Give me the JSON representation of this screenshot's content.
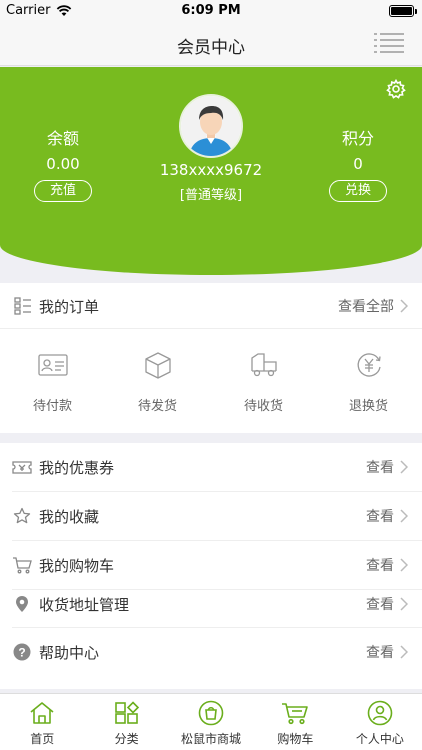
{
  "status_bar": {
    "carrier": "Carrier",
    "time": "6:09 PM"
  },
  "nav": {
    "title": "会员中心",
    "menu_icon": "list-menu-icon"
  },
  "profile": {
    "phone": "138xxxx9672",
    "level": "[普通等级]",
    "balance": {
      "label": "余额",
      "value": "0.00",
      "button": "充值"
    },
    "points": {
      "label": "积分",
      "value": "0",
      "button": "兑换"
    }
  },
  "orders": {
    "title": "我的订单",
    "view_all": "查看全部",
    "items": [
      {
        "label": "待付款",
        "icon": "payment-card-icon"
      },
      {
        "label": "待发货",
        "icon": "package-box-icon"
      },
      {
        "label": "待收货",
        "icon": "delivery-truck-icon"
      },
      {
        "label": "退换货",
        "icon": "refund-yen-icon"
      }
    ]
  },
  "menu": {
    "view_label": "查看",
    "items": [
      {
        "label": "我的优惠券",
        "icon": "coupon-icon"
      },
      {
        "label": "我的收藏",
        "icon": "star-icon"
      },
      {
        "label": "我的购物车",
        "icon": "cart-icon"
      },
      {
        "label": "收货地址管理",
        "icon": "location-pin-icon"
      },
      {
        "label": "帮助中心",
        "icon": "help-icon"
      }
    ]
  },
  "tabbar": {
    "items": [
      {
        "label": "首页",
        "icon": "home-icon"
      },
      {
        "label": "分类",
        "icon": "category-icon"
      },
      {
        "label": "松鼠市商城",
        "icon": "mall-bag-icon"
      },
      {
        "label": "购物车",
        "icon": "cart-icon"
      },
      {
        "label": "个人中心",
        "icon": "user-icon"
      }
    ]
  },
  "colors": {
    "brand": "#78bb1f",
    "tab_icon": "#6aae1c"
  }
}
